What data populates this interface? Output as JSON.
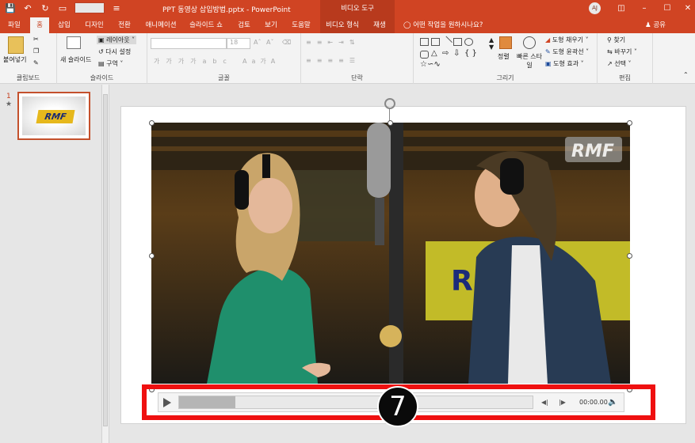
{
  "window": {
    "doc_title": "PPT 동영상 삽입방법.pptx - PowerPoint",
    "context_group": "비디오 도구",
    "user_initials": "AJ"
  },
  "tabs": [
    {
      "label": "파일"
    },
    {
      "label": "홈"
    },
    {
      "label": "삽입"
    },
    {
      "label": "디자인"
    },
    {
      "label": "전환"
    },
    {
      "label": "애니메이션"
    },
    {
      "label": "슬라이드 쇼"
    },
    {
      "label": "검토"
    },
    {
      "label": "보기"
    },
    {
      "label": "도움말"
    },
    {
      "label": "비디오 형식"
    },
    {
      "label": "재생"
    }
  ],
  "search_hint": "어떤 작업을 원하시나요?",
  "share_label": "공유",
  "ribbon": {
    "clipboard": {
      "paste": "붙여넣기",
      "group": "클립보드"
    },
    "slides": {
      "new_slide": "새 슬라이드",
      "layout": "레이아웃",
      "reset": "다시 설정",
      "section": "구역",
      "group": "슬라이드"
    },
    "font": {
      "size": "18",
      "group": "글꼴"
    },
    "paragraph": {
      "group": "단락"
    },
    "drawing": {
      "arrange": "정렬",
      "quick_styles": "빠른 스타일",
      "fill": "도형 채우기",
      "outline": "도형 윤곽선",
      "effects": "도형 효과",
      "group": "그리기"
    },
    "editing": {
      "find": "찾기",
      "replace": "바꾸기",
      "select": "선택",
      "group": "편집"
    }
  },
  "thumbnail": {
    "number": "1",
    "star": "★",
    "logo": "RMF"
  },
  "video": {
    "logo": "RMF",
    "bg_sign": "RMF",
    "player": {
      "time": "00:00.00",
      "progress": 0.16
    }
  },
  "annotation": {
    "step": "7"
  },
  "colors": {
    "accent": "#d04423",
    "highlight": "#ef1010",
    "logo_yellow": "#e6b81c"
  }
}
